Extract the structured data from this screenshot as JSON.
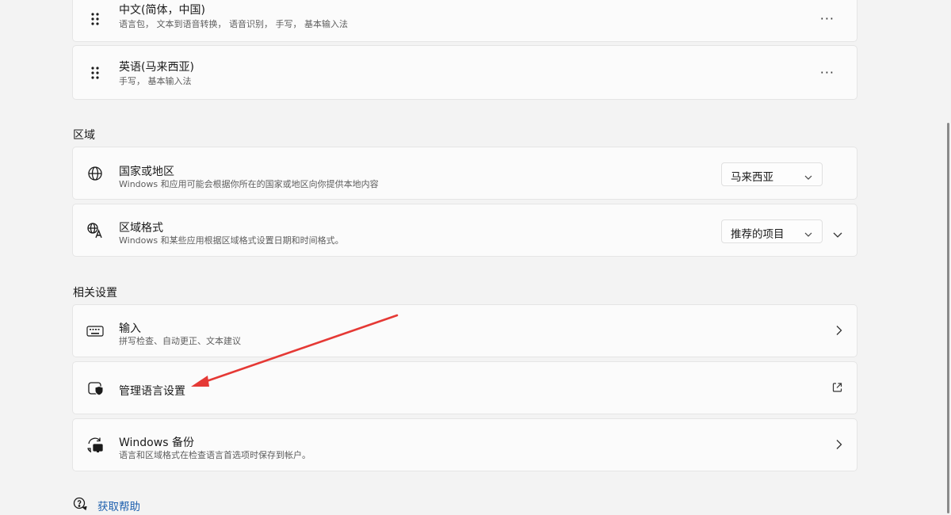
{
  "languages": [
    {
      "title": "中文(简体，中国)",
      "subtitle": "语言包， 文本到语音转换， 语音识别， 手写， 基本输入法",
      "drag_icon": "drag-handle-icon",
      "more_icon": "more-icon"
    },
    {
      "title": "英语(马来西亚)",
      "subtitle": "手写， 基本输入法",
      "drag_icon": "drag-handle-icon",
      "more_icon": "more-icon"
    }
  ],
  "region": {
    "heading": "区域",
    "country": {
      "title": "国家或地区",
      "subtitle": "Windows 和应用可能会根据你所在的国家或地区向你提供本地内容",
      "selected": "马来西亚",
      "icon": "globe-icon"
    },
    "format": {
      "title": "区域格式",
      "subtitle": "Windows 和某些应用根据区域格式设置日期和时间格式。",
      "selected": "推荐的项目",
      "icon": "region-format-icon"
    }
  },
  "related": {
    "heading": "相关设置",
    "input": {
      "title": "输入",
      "subtitle": "拼写检查、自动更正、文本建议",
      "icon": "keyboard-icon"
    },
    "manage": {
      "title": "管理语言设置",
      "icon": "language-settings-icon",
      "action_icon": "open-external-icon"
    },
    "backup": {
      "title": "Windows 备份",
      "subtitle": "语言和区域格式在检查语言首选项时保存到帐户。",
      "icon": "backup-sync-icon"
    }
  },
  "help": {
    "label": "获取帮助",
    "icon": "help-chat-icon"
  },
  "annotation": {
    "color": "#e53935"
  }
}
